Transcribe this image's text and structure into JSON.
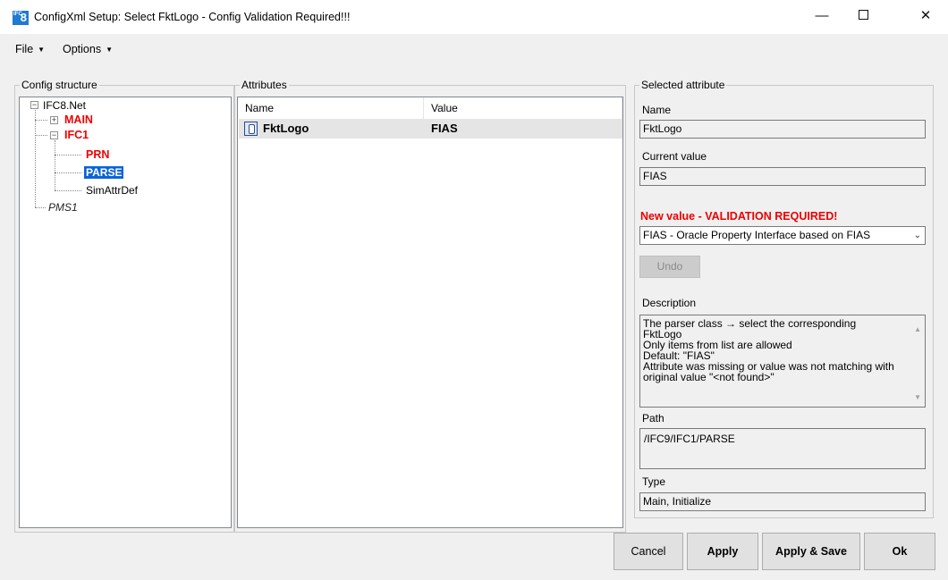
{
  "window": {
    "title": "ConfigXml Setup: Select FktLogo - Config Validation Required!!!",
    "icon_text": "8",
    "minimize_icon": "minimize-icon",
    "maximize_icon": "maximize-icon",
    "close_glyph": "✕"
  },
  "menu": {
    "file_label": "File",
    "options_label": "Options"
  },
  "config_structure": {
    "group_label": "Config structure",
    "tree": {
      "root": "IFC8.Net",
      "main": "MAIN",
      "ifc1": "IFC1",
      "prn": "PRN",
      "parse": "PARSE",
      "simattrdef": "SimAttrDef",
      "pms1": "PMS1"
    },
    "expanded_glyph": "−",
    "collapsed_glyph": "+"
  },
  "attributes": {
    "group_label": "Attributes",
    "columns": [
      "Name",
      "Value"
    ],
    "rows": [
      {
        "name": "FktLogo",
        "value": "FIAS"
      }
    ]
  },
  "selected_attribute": {
    "group_label": "Selected attribute",
    "name_label": "Name",
    "name_value": "FktLogo",
    "current_value_label": "Current value",
    "current_value": "FIAS",
    "new_value_label": "New value - VALIDATION REQUIRED!",
    "new_value_selected": "FIAS - Oracle Property Interface based on FIAS",
    "undo_label": "Undo",
    "description_label": "Description",
    "description_lines": [
      "The parser class → select the corresponding",
      "FktLogo",
      "Only items from list are allowed",
      "Default: \"FIAS\"",
      "Attribute was missing or value was not matching with",
      "original value \"<not found>\""
    ],
    "path_label": "Path",
    "path_value": "/IFC9/IFC1/PARSE",
    "type_label": "Type",
    "type_value": "Main, Initialize"
  },
  "buttons": {
    "cancel": "Cancel",
    "apply": "Apply",
    "apply_save": "Apply & Save",
    "ok": "Ok"
  },
  "colors": {
    "validation_red": "#ee0000",
    "selection_blue": "#0a64d8"
  }
}
